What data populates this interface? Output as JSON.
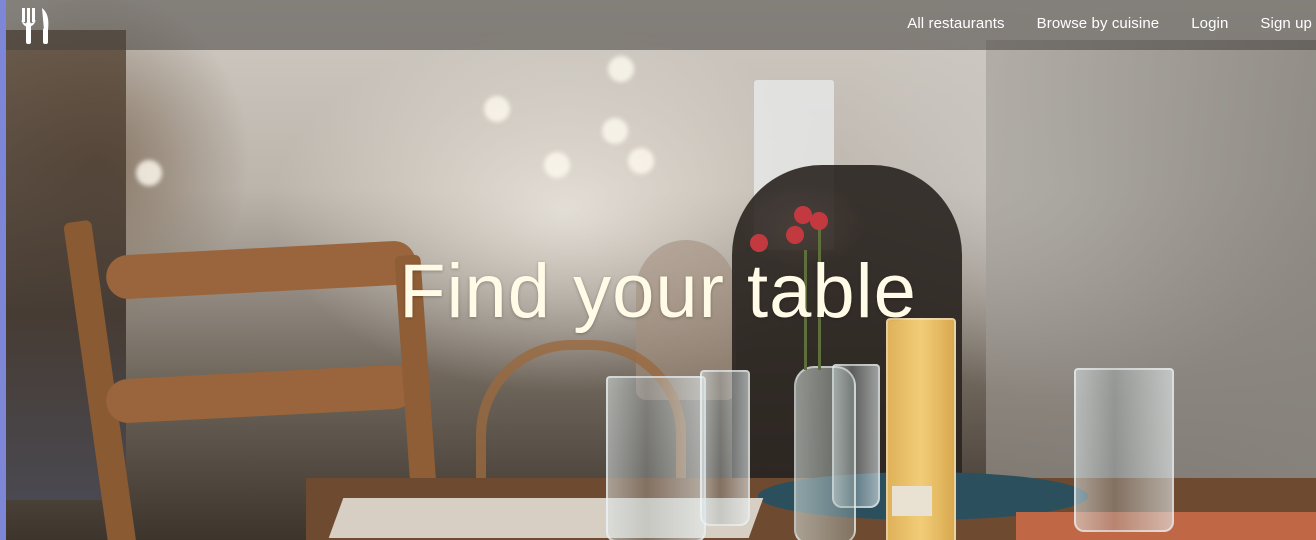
{
  "logo": {
    "icon": "fork-knife-icon",
    "color": "#ffffff"
  },
  "nav": {
    "items": [
      {
        "label": "All restaurants"
      },
      {
        "label": "Browse by cuisine"
      },
      {
        "label": "Login"
      },
      {
        "label": "Sign up"
      }
    ]
  },
  "hero": {
    "headline": "Find your table",
    "background": "restaurant-interior-photo",
    "text_color": "#fffbe6"
  }
}
